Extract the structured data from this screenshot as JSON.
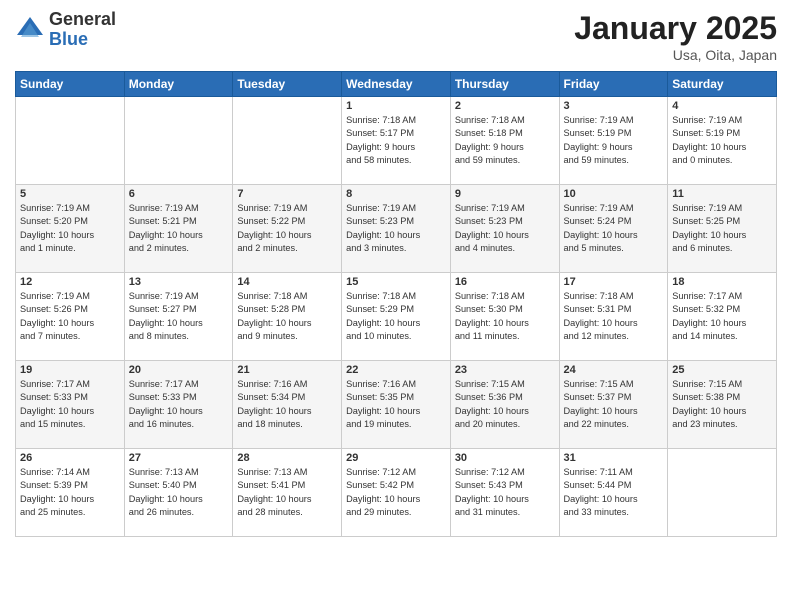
{
  "logo": {
    "general": "General",
    "blue": "Blue"
  },
  "header": {
    "title": "January 2025",
    "subtitle": "Usa, Oita, Japan"
  },
  "weekdays": [
    "Sunday",
    "Monday",
    "Tuesday",
    "Wednesday",
    "Thursday",
    "Friday",
    "Saturday"
  ],
  "weeks": [
    [
      {
        "day": "",
        "info": ""
      },
      {
        "day": "",
        "info": ""
      },
      {
        "day": "",
        "info": ""
      },
      {
        "day": "1",
        "info": "Sunrise: 7:18 AM\nSunset: 5:17 PM\nDaylight: 9 hours\nand 58 minutes."
      },
      {
        "day": "2",
        "info": "Sunrise: 7:18 AM\nSunset: 5:18 PM\nDaylight: 9 hours\nand 59 minutes."
      },
      {
        "day": "3",
        "info": "Sunrise: 7:19 AM\nSunset: 5:19 PM\nDaylight: 9 hours\nand 59 minutes."
      },
      {
        "day": "4",
        "info": "Sunrise: 7:19 AM\nSunset: 5:19 PM\nDaylight: 10 hours\nand 0 minutes."
      }
    ],
    [
      {
        "day": "5",
        "info": "Sunrise: 7:19 AM\nSunset: 5:20 PM\nDaylight: 10 hours\nand 1 minute."
      },
      {
        "day": "6",
        "info": "Sunrise: 7:19 AM\nSunset: 5:21 PM\nDaylight: 10 hours\nand 2 minutes."
      },
      {
        "day": "7",
        "info": "Sunrise: 7:19 AM\nSunset: 5:22 PM\nDaylight: 10 hours\nand 2 minutes."
      },
      {
        "day": "8",
        "info": "Sunrise: 7:19 AM\nSunset: 5:23 PM\nDaylight: 10 hours\nand 3 minutes."
      },
      {
        "day": "9",
        "info": "Sunrise: 7:19 AM\nSunset: 5:23 PM\nDaylight: 10 hours\nand 4 minutes."
      },
      {
        "day": "10",
        "info": "Sunrise: 7:19 AM\nSunset: 5:24 PM\nDaylight: 10 hours\nand 5 minutes."
      },
      {
        "day": "11",
        "info": "Sunrise: 7:19 AM\nSunset: 5:25 PM\nDaylight: 10 hours\nand 6 minutes."
      }
    ],
    [
      {
        "day": "12",
        "info": "Sunrise: 7:19 AM\nSunset: 5:26 PM\nDaylight: 10 hours\nand 7 minutes."
      },
      {
        "day": "13",
        "info": "Sunrise: 7:19 AM\nSunset: 5:27 PM\nDaylight: 10 hours\nand 8 minutes."
      },
      {
        "day": "14",
        "info": "Sunrise: 7:18 AM\nSunset: 5:28 PM\nDaylight: 10 hours\nand 9 minutes."
      },
      {
        "day": "15",
        "info": "Sunrise: 7:18 AM\nSunset: 5:29 PM\nDaylight: 10 hours\nand 10 minutes."
      },
      {
        "day": "16",
        "info": "Sunrise: 7:18 AM\nSunset: 5:30 PM\nDaylight: 10 hours\nand 11 minutes."
      },
      {
        "day": "17",
        "info": "Sunrise: 7:18 AM\nSunset: 5:31 PM\nDaylight: 10 hours\nand 12 minutes."
      },
      {
        "day": "18",
        "info": "Sunrise: 7:17 AM\nSunset: 5:32 PM\nDaylight: 10 hours\nand 14 minutes."
      }
    ],
    [
      {
        "day": "19",
        "info": "Sunrise: 7:17 AM\nSunset: 5:33 PM\nDaylight: 10 hours\nand 15 minutes."
      },
      {
        "day": "20",
        "info": "Sunrise: 7:17 AM\nSunset: 5:33 PM\nDaylight: 10 hours\nand 16 minutes."
      },
      {
        "day": "21",
        "info": "Sunrise: 7:16 AM\nSunset: 5:34 PM\nDaylight: 10 hours\nand 18 minutes."
      },
      {
        "day": "22",
        "info": "Sunrise: 7:16 AM\nSunset: 5:35 PM\nDaylight: 10 hours\nand 19 minutes."
      },
      {
        "day": "23",
        "info": "Sunrise: 7:15 AM\nSunset: 5:36 PM\nDaylight: 10 hours\nand 20 minutes."
      },
      {
        "day": "24",
        "info": "Sunrise: 7:15 AM\nSunset: 5:37 PM\nDaylight: 10 hours\nand 22 minutes."
      },
      {
        "day": "25",
        "info": "Sunrise: 7:15 AM\nSunset: 5:38 PM\nDaylight: 10 hours\nand 23 minutes."
      }
    ],
    [
      {
        "day": "26",
        "info": "Sunrise: 7:14 AM\nSunset: 5:39 PM\nDaylight: 10 hours\nand 25 minutes."
      },
      {
        "day": "27",
        "info": "Sunrise: 7:13 AM\nSunset: 5:40 PM\nDaylight: 10 hours\nand 26 minutes."
      },
      {
        "day": "28",
        "info": "Sunrise: 7:13 AM\nSunset: 5:41 PM\nDaylight: 10 hours\nand 28 minutes."
      },
      {
        "day": "29",
        "info": "Sunrise: 7:12 AM\nSunset: 5:42 PM\nDaylight: 10 hours\nand 29 minutes."
      },
      {
        "day": "30",
        "info": "Sunrise: 7:12 AM\nSunset: 5:43 PM\nDaylight: 10 hours\nand 31 minutes."
      },
      {
        "day": "31",
        "info": "Sunrise: 7:11 AM\nSunset: 5:44 PM\nDaylight: 10 hours\nand 33 minutes."
      },
      {
        "day": "",
        "info": ""
      }
    ]
  ]
}
